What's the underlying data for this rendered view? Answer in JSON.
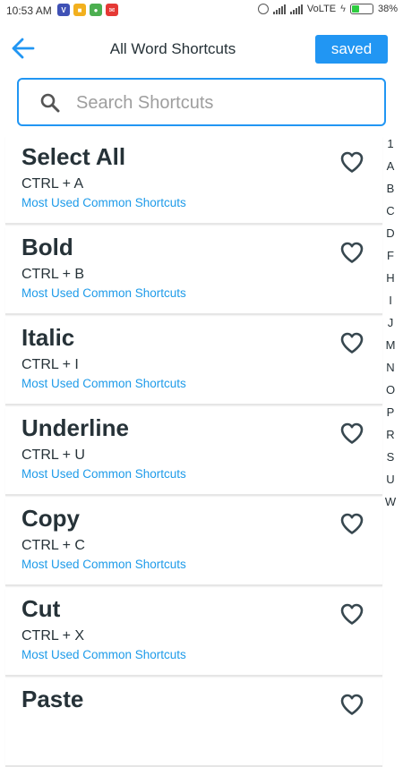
{
  "status_bar": {
    "time": "10:53 AM",
    "network": "VoLTE",
    "battery": "38%",
    "battery_level": 0.38,
    "icons": [
      "shield-icon",
      "notification-icon",
      "android-icon",
      "mail-icon",
      "alarm-icon",
      "signal-icon",
      "charging-icon",
      "battery-icon"
    ]
  },
  "header": {
    "title": "All Word Shortcuts",
    "saved_label": "saved"
  },
  "search": {
    "placeholder": "Search Shortcuts",
    "value": ""
  },
  "shortcuts": [
    {
      "name": "Select All",
      "keys": "CTRL + A",
      "category": "Most Used Common Shortcuts"
    },
    {
      "name": "Bold",
      "keys": "CTRL + B",
      "category": "Most Used Common Shortcuts"
    },
    {
      "name": "Italic",
      "keys": "CTRL + I",
      "category": "Most Used Common Shortcuts"
    },
    {
      "name": "Underline",
      "keys": "CTRL + U",
      "category": "Most Used Common Shortcuts"
    },
    {
      "name": "Copy",
      "keys": "CTRL + C",
      "category": "Most Used Common Shortcuts"
    },
    {
      "name": "Cut",
      "keys": "CTRL + X",
      "category": "Most Used Common Shortcuts"
    },
    {
      "name": "Paste",
      "keys": "",
      "category": ""
    }
  ],
  "alphabet_index": [
    "1",
    "A",
    "B",
    "C",
    "D",
    "F",
    "H",
    "I",
    "J",
    "M",
    "N",
    "O",
    "P",
    "R",
    "S",
    "U",
    "W"
  ],
  "colors": {
    "accent": "#2196f3",
    "category_text": "#1e9be9",
    "title_text": "#263238"
  }
}
